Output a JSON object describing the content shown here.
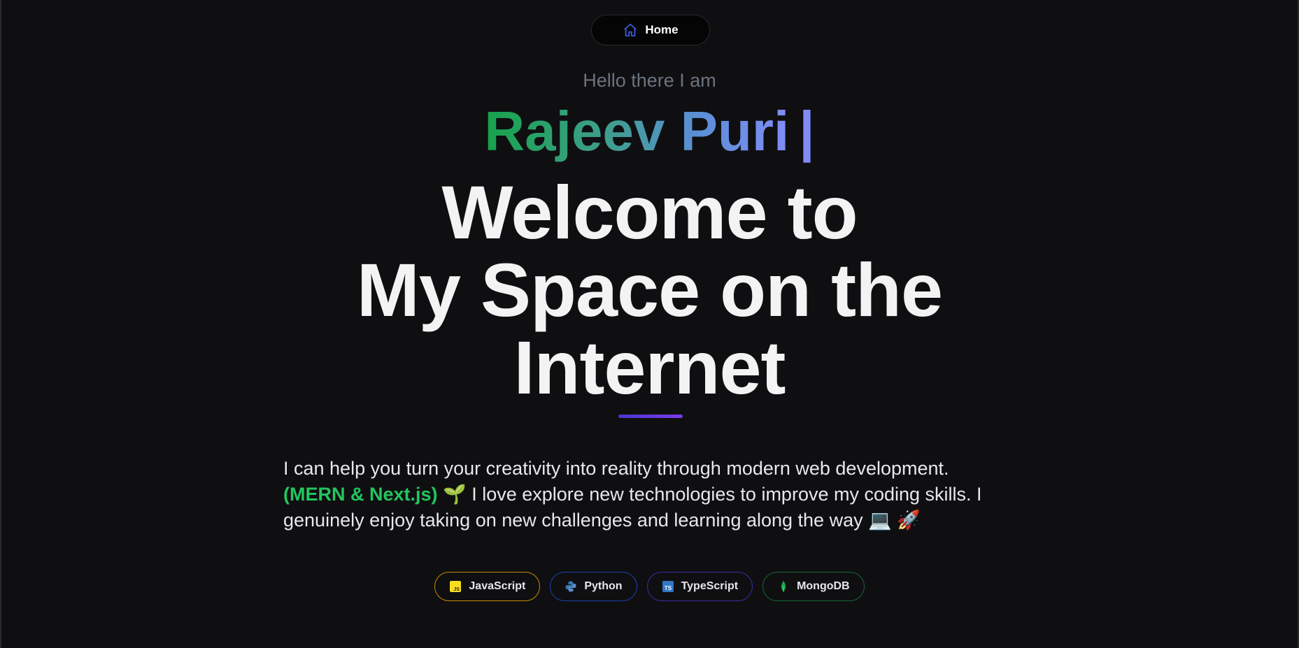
{
  "nav": {
    "home_label": "Home",
    "home_icon": "home-icon",
    "icon_color": "#3b5bdb"
  },
  "hero": {
    "greeting": "Hello there I am",
    "name": "Rajeev Puri",
    "cursor": "|",
    "headline_line1": "Welcome to",
    "headline_line2": "My Space on the",
    "headline_line3": "Internet"
  },
  "bio": {
    "text_before": "I can help you turn your creativity into reality through modern web development.",
    "highlight": "(MERN & Next.js)",
    "emoji_seedling": "🌱",
    "text_middle": "I love explore new technologies to improve my coding skills. I genuinely enjoy taking on new challenges and learning along the way",
    "emoji_laptop": "💻",
    "emoji_rocket": "🚀",
    "highlight_color": "#22c55e"
  },
  "skills": [
    {
      "label": "JavaScript",
      "icon": "javascript-icon",
      "border_color": "#ca8a04"
    },
    {
      "label": "Python",
      "icon": "python-icon",
      "border_color": "#1e40af"
    },
    {
      "label": "TypeScript",
      "icon": "typescript-icon",
      "border_color": "#3730a3"
    },
    {
      "label": "MongoDB",
      "icon": "mongodb-icon",
      "border_color": "#166534"
    }
  ]
}
